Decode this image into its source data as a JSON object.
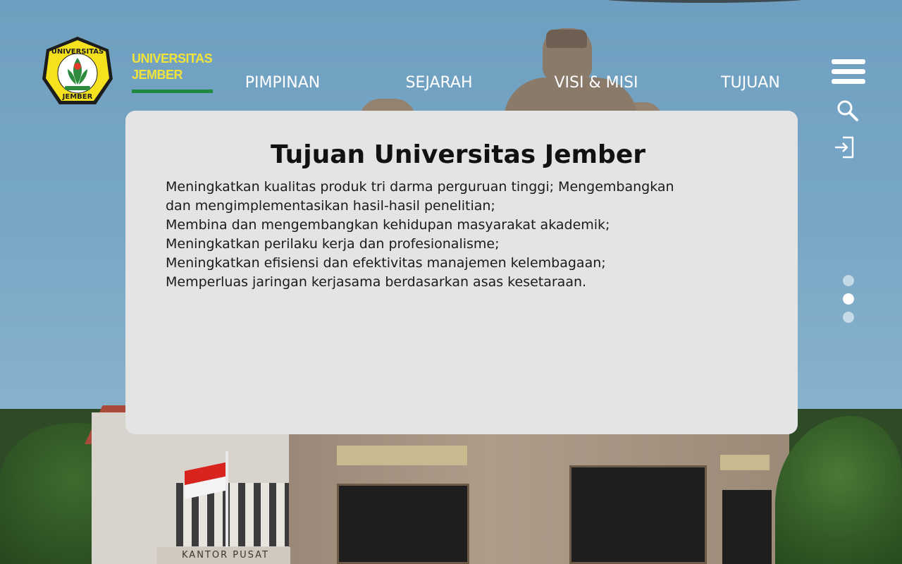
{
  "brand": {
    "name": "UNIVERSITAS\nJEMBER",
    "logo_text_top": "UNIVERSITAS",
    "logo_text_bottom": "JEMBER",
    "name_color": "#f2e33a",
    "underline_color": "#1f8a3e"
  },
  "nav": {
    "items": [
      {
        "label": "PIMPINAN"
      },
      {
        "label": "SEJARAH"
      },
      {
        "label": "VISI & MISI"
      },
      {
        "label": "TUJUAN"
      }
    ]
  },
  "toolbar": {
    "icons": [
      "menu-icon",
      "search-icon",
      "login-icon"
    ]
  },
  "content": {
    "title": "Tujuan Universitas Jember",
    "goals": [
      "Meningkatkan kualitas produk tri darma perguruan tinggi; Mengembangkan dan mengimplementasikan hasil-hasil penelitian;",
      "Membina dan mengembangkan kehidupan masyarakat akademik;",
      "Meningkatkan perilaku kerja dan profesionalisme;",
      "Meningkatkan efisiensi dan efektivitas manajemen kelembagaan;",
      "Memperluas jaringan kerjasama berdasarkan asas kesetaraan."
    ]
  },
  "pagination": {
    "total": 3,
    "active_index": 1
  },
  "background": {
    "kantor_label": "KANTOR PUSAT"
  }
}
